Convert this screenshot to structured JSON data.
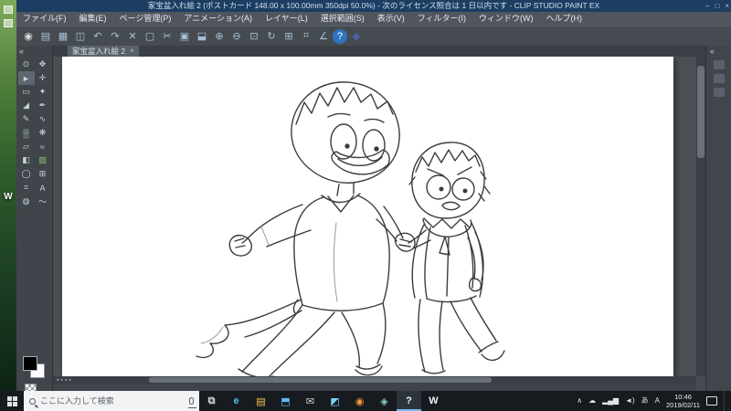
{
  "colors": {
    "titlebar_bg": "#1d3d63",
    "ui_gray": "#474c52",
    "taskbar_bg": "#171a1f",
    "active_app_underline": "#76b9ed",
    "canvas_bg": "#ffffff",
    "foreground_color": "#000000",
    "background_color": "#ffffff"
  },
  "titlebar": {
    "title": "家宝盆入れ絵 2 (ポストカード 148.00 x 100.00mm 350dpi 50.0%) - 次のライセンス照合は 1 日以内です - CLIP STUDIO PAINT EX",
    "minimize": "–",
    "maximize": "□",
    "close": "×"
  },
  "menubar": {
    "items": [
      {
        "name": "menu-file",
        "label": "ファイル(F)"
      },
      {
        "name": "menu-edit",
        "label": "編集(E)"
      },
      {
        "name": "menu-page",
        "label": "ページ管理(P)"
      },
      {
        "name": "menu-animation",
        "label": "アニメーション(A)"
      },
      {
        "name": "menu-layer",
        "label": "レイヤー(L)"
      },
      {
        "name": "menu-selection",
        "label": "選択範囲(S)"
      },
      {
        "name": "menu-view",
        "label": "表示(V)"
      },
      {
        "name": "menu-filter",
        "label": "フィルター(I)"
      },
      {
        "name": "menu-window",
        "label": "ウィンドウ(W)"
      },
      {
        "name": "menu-help",
        "label": "ヘルプ(H)"
      }
    ]
  },
  "toolbar": {
    "tools": [
      {
        "name": "clip-studio-logo-icon",
        "glyph": "◉",
        "color": "#d9dee3"
      },
      {
        "name": "new-file-icon",
        "glyph": "▤"
      },
      {
        "name": "open-file-icon",
        "glyph": "▦"
      },
      {
        "name": "save-file-icon",
        "glyph": "◫"
      },
      {
        "name": "undo-icon",
        "glyph": "↶"
      },
      {
        "name": "redo-icon",
        "glyph": "↷"
      },
      {
        "name": "delete-icon",
        "glyph": "✕"
      },
      {
        "name": "deselect-icon",
        "glyph": "▢"
      },
      {
        "name": "cut-icon",
        "glyph": "✂"
      },
      {
        "name": "copy-icon",
        "glyph": "▣"
      },
      {
        "name": "paste-icon",
        "glyph": "⬓"
      },
      {
        "name": "zoom-in-icon",
        "glyph": "⊕"
      },
      {
        "name": "zoom-out-icon",
        "glyph": "⊖"
      },
      {
        "name": "fit-to-screen-icon",
        "glyph": "⊡"
      },
      {
        "name": "rotate-reset-icon",
        "glyph": "↻"
      },
      {
        "name": "grid-icon",
        "glyph": "⊞"
      },
      {
        "name": "snap-ruler-icon",
        "glyph": "⌗"
      },
      {
        "name": "snap-special-icon",
        "glyph": "∠"
      },
      {
        "name": "help-icon",
        "glyph": "?",
        "active": true
      },
      {
        "name": "reference-icon",
        "glyph": "◆",
        "color": "#4d64a0"
      }
    ]
  },
  "document_tab": {
    "label": "家宝盆入れ絵 2",
    "close": "×"
  },
  "tool_palette": {
    "collapse": "«",
    "tools": [
      {
        "name": "zoom-tool",
        "glyph": "⊙"
      },
      {
        "name": "move-tool",
        "glyph": "✥"
      },
      {
        "name": "operation-tool",
        "glyph": "►",
        "active": true
      },
      {
        "name": "layer-move-tool",
        "glyph": "✛"
      },
      {
        "name": "selection-tool",
        "glyph": "▭"
      },
      {
        "name": "auto-select-tool",
        "glyph": "✦"
      },
      {
        "name": "eyedropper-tool",
        "glyph": "◢"
      },
      {
        "name": "pen-tool",
        "glyph": "✒"
      },
      {
        "name": "pencil-tool",
        "glyph": "✎"
      },
      {
        "name": "brush-tool",
        "glyph": "∿"
      },
      {
        "name": "airbrush-tool",
        "glyph": "▒"
      },
      {
        "name": "decoration-tool",
        "glyph": "❋"
      },
      {
        "name": "eraser-tool",
        "glyph": "▱"
      },
      {
        "name": "blend-tool",
        "glyph": "≈"
      },
      {
        "name": "fill-tool",
        "glyph": "◧"
      },
      {
        "name": "gradient-tool",
        "glyph": "▨",
        "color": "#86c06c"
      },
      {
        "name": "figure-tool",
        "glyph": "◯"
      },
      {
        "name": "frame-border-tool",
        "glyph": "⊞"
      },
      {
        "name": "ruler-tool",
        "glyph": "⌗"
      },
      {
        "name": "text-tool",
        "glyph": "A"
      },
      {
        "name": "balloon-tool",
        "glyph": "◍"
      },
      {
        "name": "line-correction-tool",
        "glyph": "〜"
      }
    ]
  },
  "right_rail": {
    "collapse": "«"
  },
  "desktop": {
    "shortcut_label": "W"
  },
  "taskbar": {
    "search": {
      "placeholder": "ここに入力して検索"
    },
    "apps": [
      {
        "name": "task-view-icon",
        "glyph": "⧉",
        "color": "#cfd6dd"
      },
      {
        "name": "edge-icon",
        "glyph": "e",
        "color": "#4fc1f0"
      },
      {
        "name": "file-explorer-icon",
        "glyph": "▤",
        "color": "#f5c84b"
      },
      {
        "name": "store-icon",
        "glyph": "⬒",
        "color": "#5fb8f5"
      },
      {
        "name": "mail-icon",
        "glyph": "✉",
        "color": "#cfd6dd"
      },
      {
        "name": "photos-icon",
        "glyph": "◩",
        "color": "#7fd0f7"
      },
      {
        "name": "firefox-icon",
        "glyph": "◉",
        "color": "#f59b3c"
      },
      {
        "name": "paint-app-icon",
        "glyph": "◈",
        "color": "#8fd0c8"
      },
      {
        "name": "clip-studio-paint-icon",
        "glyph": "?",
        "color": "#eef2f5",
        "active": true
      },
      {
        "name": "clip-studio-icon",
        "glyph": "W",
        "color": "#f0f2f4"
      }
    ],
    "tray_icons": [
      {
        "name": "tray-expand-icon",
        "glyph": "∧"
      },
      {
        "name": "onedrive-icon",
        "glyph": "☁"
      },
      {
        "name": "network-icon",
        "glyph": "▂▄▆"
      },
      {
        "name": "volume-icon",
        "glyph": "◄)"
      },
      {
        "name": "ime-lang-icon",
        "glyph": "あ"
      },
      {
        "name": "ime-mode-icon",
        "glyph": "A"
      }
    ],
    "clock": {
      "time": "10:46",
      "date": "2019/02/11"
    }
  }
}
